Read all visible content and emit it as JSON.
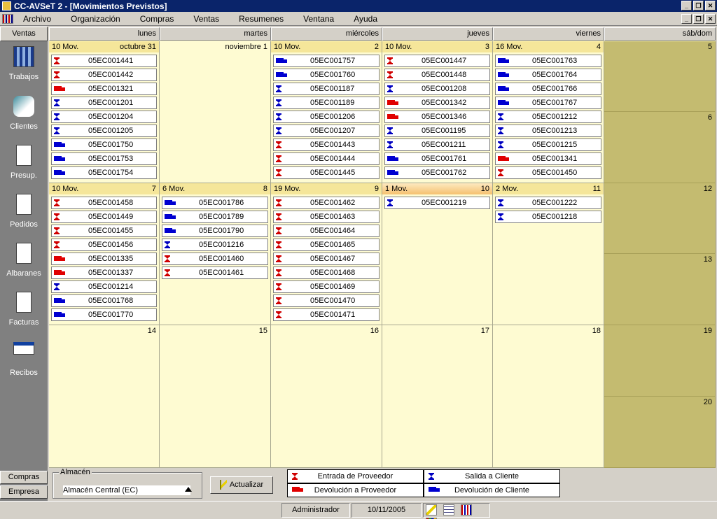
{
  "window": {
    "title": "CC-AVSeT 2 - [Movimientos Previstos]"
  },
  "menu": [
    "Archivo",
    "Organización",
    "Compras",
    "Ventas",
    "Resumenes",
    "Ventana",
    "Ayuda"
  ],
  "sidebar": {
    "header": "Ventas",
    "items": [
      {
        "label": "Trabajos",
        "icon": "film-icon"
      },
      {
        "label": "Clientes",
        "icon": "handshake-icon"
      },
      {
        "label": "Presup.",
        "icon": "question-document-icon"
      },
      {
        "label": "Pedidos",
        "icon": "hourglass-document-icon"
      },
      {
        "label": "Albaranes",
        "icon": "truck-document-icon"
      },
      {
        "label": "Facturas",
        "icon": "euro-document-icon"
      },
      {
        "label": "Recibos",
        "icon": "receipt-icon"
      }
    ],
    "bottom": [
      "Compras",
      "Empresa"
    ]
  },
  "calendar": {
    "days": [
      "lunes",
      "martes",
      "miércoles",
      "jueves",
      "viernes",
      "sáb/dom"
    ],
    "weeks": [
      {
        "cells": [
          {
            "left": "10 Mov.",
            "right": "octubre 31",
            "entries": [
              {
                "code": "05EC001441",
                "icon": "hg-red"
              },
              {
                "code": "05EC001442",
                "icon": "hg-red"
              },
              {
                "code": "05EC001321",
                "icon": "truck-red"
              },
              {
                "code": "05EC001201",
                "icon": "hg-blue"
              },
              {
                "code": "05EC001204",
                "icon": "hg-blue"
              },
              {
                "code": "05EC001205",
                "icon": "hg-blue"
              },
              {
                "code": "05EC001750",
                "icon": "truck-blue"
              },
              {
                "code": "05EC001753",
                "icon": "truck-blue"
              },
              {
                "code": "05EC001754",
                "icon": "truck-blue"
              }
            ]
          },
          {
            "left": "",
            "right": "noviembre 1",
            "entries": []
          },
          {
            "left": "10 Mov.",
            "right": "2",
            "entries": [
              {
                "code": "05EC001757",
                "icon": "truck-blue"
              },
              {
                "code": "05EC001760",
                "icon": "truck-blue"
              },
              {
                "code": "05EC001187",
                "icon": "hg-blue"
              },
              {
                "code": "05EC001189",
                "icon": "hg-blue"
              },
              {
                "code": "05EC001206",
                "icon": "hg-blue"
              },
              {
                "code": "05EC001207",
                "icon": "hg-blue"
              },
              {
                "code": "05EC001443",
                "icon": "hg-red"
              },
              {
                "code": "05EC001444",
                "icon": "hg-red"
              },
              {
                "code": "05EC001445",
                "icon": "hg-red"
              }
            ]
          },
          {
            "left": "10 Mov.",
            "right": "3",
            "entries": [
              {
                "code": "05EC001447",
                "icon": "hg-red"
              },
              {
                "code": "05EC001448",
                "icon": "hg-red"
              },
              {
                "code": "05EC001208",
                "icon": "hg-blue"
              },
              {
                "code": "05EC001342",
                "icon": "truck-red"
              },
              {
                "code": "05EC001346",
                "icon": "truck-red"
              },
              {
                "code": "05EC001195",
                "icon": "hg-blue"
              },
              {
                "code": "05EC001211",
                "icon": "hg-blue"
              },
              {
                "code": "05EC001761",
                "icon": "truck-blue"
              },
              {
                "code": "05EC001762",
                "icon": "truck-blue"
              }
            ]
          },
          {
            "left": "16 Mov.",
            "right": "4",
            "entries": [
              {
                "code": "05EC001763",
                "icon": "truck-blue"
              },
              {
                "code": "05EC001764",
                "icon": "truck-blue"
              },
              {
                "code": "05EC001766",
                "icon": "truck-blue"
              },
              {
                "code": "05EC001767",
                "icon": "truck-blue"
              },
              {
                "code": "05EC001212",
                "icon": "hg-blue"
              },
              {
                "code": "05EC001213",
                "icon": "hg-blue"
              },
              {
                "code": "05EC001215",
                "icon": "hg-blue"
              },
              {
                "code": "05EC001341",
                "icon": "truck-red"
              },
              {
                "code": "05EC001450",
                "icon": "hg-red"
              }
            ]
          },
          {
            "weekend": [
              "5",
              "6"
            ]
          }
        ]
      },
      {
        "cells": [
          {
            "left": "10 Mov.",
            "right": "7",
            "entries": [
              {
                "code": "05EC001458",
                "icon": "hg-red"
              },
              {
                "code": "05EC001449",
                "icon": "hg-red"
              },
              {
                "code": "05EC001455",
                "icon": "hg-red"
              },
              {
                "code": "05EC001456",
                "icon": "hg-red"
              },
              {
                "code": "05EC001335",
                "icon": "truck-red"
              },
              {
                "code": "05EC001337",
                "icon": "truck-red"
              },
              {
                "code": "05EC001214",
                "icon": "hg-blue"
              },
              {
                "code": "05EC001768",
                "icon": "truck-blue"
              },
              {
                "code": "05EC001770",
                "icon": "truck-blue"
              }
            ]
          },
          {
            "left": "6 Mov.",
            "right": "8",
            "entries": [
              {
                "code": "05EC001786",
                "icon": "truck-blue"
              },
              {
                "code": "05EC001789",
                "icon": "truck-blue"
              },
              {
                "code": "05EC001790",
                "icon": "truck-blue"
              },
              {
                "code": "05EC001216",
                "icon": "hg-blue"
              },
              {
                "code": "05EC001460",
                "icon": "hg-red"
              },
              {
                "code": "05EC001461",
                "icon": "hg-red"
              }
            ]
          },
          {
            "left": "19 Mov.",
            "right": "9",
            "entries": [
              {
                "code": "05EC001462",
                "icon": "hg-red"
              },
              {
                "code": "05EC001463",
                "icon": "hg-red"
              },
              {
                "code": "05EC001464",
                "icon": "hg-red"
              },
              {
                "code": "05EC001465",
                "icon": "hg-red"
              },
              {
                "code": "05EC001467",
                "icon": "hg-red"
              },
              {
                "code": "05EC001468",
                "icon": "hg-red"
              },
              {
                "code": "05EC001469",
                "icon": "hg-red"
              },
              {
                "code": "05EC001470",
                "icon": "hg-red"
              },
              {
                "code": "05EC001471",
                "icon": "hg-red"
              }
            ]
          },
          {
            "left": "1 Mov.",
            "right": "10",
            "today": true,
            "entries": [
              {
                "code": "05EC001219",
                "icon": "hg-blue"
              }
            ]
          },
          {
            "left": "2 Mov.",
            "right": "11",
            "entries": [
              {
                "code": "05EC001222",
                "icon": "hg-blue"
              },
              {
                "code": "05EC001218",
                "icon": "hg-blue"
              }
            ]
          },
          {
            "weekend": [
              "12",
              "13"
            ]
          }
        ]
      },
      {
        "cells": [
          {
            "left": "",
            "right": "14",
            "entries": []
          },
          {
            "left": "",
            "right": "15",
            "entries": []
          },
          {
            "left": "",
            "right": "16",
            "entries": []
          },
          {
            "left": "",
            "right": "17",
            "entries": []
          },
          {
            "left": "",
            "right": "18",
            "entries": []
          },
          {
            "weekend": [
              "19",
              "20"
            ]
          }
        ]
      }
    ]
  },
  "bottom": {
    "group_label": "Almacén",
    "warehouse_label": "Almacén",
    "warehouse_value": "Central (EC)",
    "refresh_button": "Actualizar",
    "legend": [
      {
        "label": "Entrada de Proveedor",
        "icon": "hg-red"
      },
      {
        "label": "Salida a Cliente",
        "icon": "hg-blue"
      },
      {
        "label": "Devolución a Proveedor",
        "icon": "truck-red"
      },
      {
        "label": "Devolución de Cliente",
        "icon": "truck-blue"
      }
    ]
  },
  "status": {
    "user": "Administrador",
    "date": "10/11/2005"
  },
  "colors": {
    "title_bar": "#0a246a",
    "calendar_bg": "#fefbd2",
    "weekend_bg": "#c4bb70",
    "entrada": "#d00000",
    "salida": "#0000c0"
  }
}
